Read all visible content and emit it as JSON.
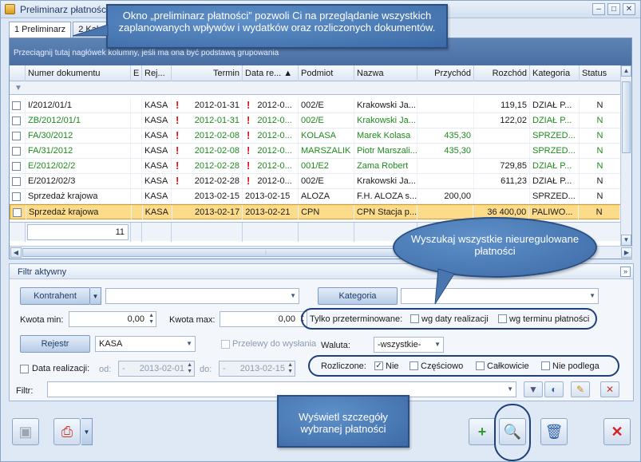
{
  "window": {
    "title": "Preliminarz płatności"
  },
  "tabs": [
    {
      "label": "1 Preliminarz"
    },
    {
      "label": "2 Kalendarz"
    }
  ],
  "grid": {
    "group_hint": "Przeciągnij tutaj nagłówek kolumny, jeśli ma ona być podstawą grupowania",
    "columns": [
      "Numer dokumentu",
      "E",
      "Rej...",
      "Termin",
      "Data re... ▲",
      "Podmiot",
      "Nazwa",
      "Przychód",
      "Rozchód",
      "Kategoria",
      "Status"
    ],
    "rows": [
      {
        "numer": "I/2012/01/1",
        "rej": "KASA",
        "flag1": "!",
        "termin": "2012-01-31",
        "flag2": "!",
        "data": "2012-0...",
        "podmiot": "002/E",
        "nazwa": "Krakowski Ja...",
        "przychod": "",
        "rozchod": "119,15",
        "kategoria": "DZIAŁ P...",
        "status": "N"
      },
      {
        "numer": "ZB/2012/01/1",
        "rej": "KASA",
        "flag1": "!",
        "termin": "2012-01-31",
        "flag2": "!",
        "data": "2012-0...",
        "podmiot": "002/E",
        "nazwa": "Krakowski Ja...",
        "przychod": "",
        "rozchod": "122,02",
        "kategoria": "DZIAŁ P...",
        "status": "N"
      },
      {
        "numer": "FA/30/2012",
        "rej": "KASA",
        "flag1": "!",
        "termin": "2012-02-08",
        "flag2": "!",
        "data": "2012-0...",
        "podmiot": "KOLASA",
        "nazwa": "Marek Kolasa",
        "przychod": "435,30",
        "rozchod": "",
        "kategoria": "SPRZED...",
        "status": "N"
      },
      {
        "numer": "FA/31/2012",
        "rej": "KASA",
        "flag1": "!",
        "termin": "2012-02-08",
        "flag2": "!",
        "data": "2012-0...",
        "podmiot": "MARSZALIK",
        "nazwa": "Piotr Marszali...",
        "przychod": "435,30",
        "rozchod": "",
        "kategoria": "SPRZED...",
        "status": "N"
      },
      {
        "numer": "E/2012/02/2",
        "rej": "KASA",
        "flag1": "!",
        "termin": "2012-02-28",
        "flag2": "!",
        "data": "2012-0...",
        "podmiot": "001/E2",
        "nazwa": "Zama Robert",
        "przychod": "",
        "rozchod": "729,85",
        "kategoria": "DZIAŁ P...",
        "status": "N"
      },
      {
        "numer": "E/2012/02/3",
        "rej": "KASA",
        "flag1": "!",
        "termin": "2012-02-28",
        "flag2": "!",
        "data": "2012-0...",
        "podmiot": "002/E",
        "nazwa": "Krakowski Ja...",
        "przychod": "",
        "rozchod": "611,23",
        "kategoria": "DZIAŁ P...",
        "status": "N"
      },
      {
        "numer": "Sprzedaż krajowa",
        "rej": "KASA",
        "flag1": "",
        "termin": "2013-02-15",
        "flag2": "",
        "data": "2013-02-15",
        "podmiot": "ALOZA",
        "nazwa": "F.H. ALOZA s...",
        "przychod": "200,00",
        "rozchod": "",
        "kategoria": "SPRZED...",
        "status": "N"
      },
      {
        "numer": "Sprzedaż krajowa",
        "rej": "KASA",
        "flag1": "",
        "termin": "2013-02-17",
        "flag2": "",
        "data": "2013-02-21",
        "podmiot": "CPN",
        "nazwa": "CPN Stacja p...",
        "przychod": "",
        "rozchod": "36 400,00",
        "kategoria": "PALIWO...",
        "status": "N"
      }
    ],
    "row_count": "11"
  },
  "filter": {
    "title": "Filtr aktywny",
    "kontrahent_btn": "Kontrahent",
    "kategoria_btn": "Kategoria",
    "kwota_min_label": "Kwota min:",
    "kwota_min": "0,00",
    "kwota_max_label": "Kwota max:",
    "kwota_max": "0,00",
    "tylko_label": "Tylko przeterminowane:",
    "wg_daty": "wg daty realizacji",
    "wg_terminu": "wg terminu płatności",
    "rejestr_btn": "Rejestr",
    "rejestr_value": "KASA",
    "przelewy": "Przelewy do wysłania",
    "waluta_label": "Waluta:",
    "waluta_value": "-wszystkie-",
    "data_realizacji": "Data realizacji:",
    "od_label": "od:",
    "od_value": "2013-02-01",
    "do_label": "do:",
    "do_value": "2013-02-15",
    "rozliczone_label": "Rozliczone:",
    "nie": "Nie",
    "czesciowo": "Częściowo",
    "calkowicie": "Całkowicie",
    "nie_podlega": "Nie podlega",
    "filtr_label": "Filtr:"
  },
  "callouts": {
    "top": "Okno „preliminarz płatności” pozwoli Ci na przeglądanie wszystkich zaplanowanych wpływów i wydatków oraz rozliczonych dokumentów.",
    "middle": "Wyszukaj wszystkie nieuregulowane płatności",
    "bottom": "Wyświetl szczegóły wybranej płatności"
  },
  "colors": {
    "accent": "#3c6aa6",
    "selected_row": "#fcdc8a",
    "overdue": "#d11111",
    "green_text": "#1f8a1f"
  }
}
